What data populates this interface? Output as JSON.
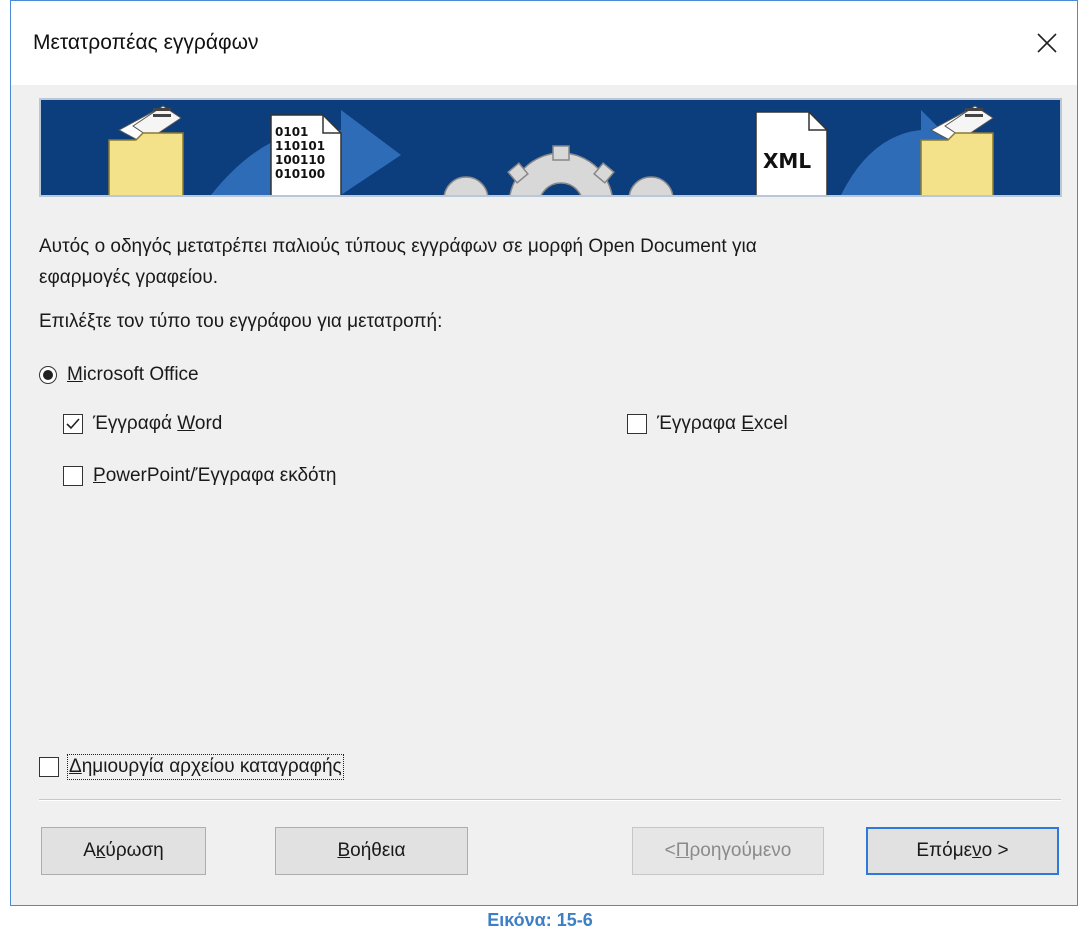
{
  "window": {
    "title": "Μετατροπέας εγγράφων",
    "close_glyph": "✕"
  },
  "banner": {
    "binary_lines": [
      "0101",
      "110101",
      "100110",
      "010100"
    ],
    "xml_label": "XML",
    "colors": {
      "background": "#0c3d7c",
      "arrow": "#2f6cb8",
      "folder": "#f3e28a"
    }
  },
  "content": {
    "description_line1": "Αυτός ο οδηγός μετατρέπει παλιούς τύπους εγγράφων σε μορφή Open Document για",
    "description_line2": "εφαρμογές γραφείου.",
    "prompt": "Επιλέξτε τον τύπο του εγγράφου για μετατροπή:"
  },
  "options": {
    "microsoft_office": {
      "prefix": "",
      "mnemonic": "M",
      "rest": "icrosoft Office",
      "selected": true
    },
    "word": {
      "prefix": "Έγγραφά ",
      "mnemonic": "W",
      "rest": "ord",
      "checked": true
    },
    "excel": {
      "prefix": "Έγγραφα ",
      "mnemonic": "E",
      "rest": "xcel",
      "checked": false
    },
    "powerpoint": {
      "prefix": "",
      "mnemonic": "P",
      "rest": "owerPoint/Έγγραφα εκδότη",
      "checked": false
    },
    "create_log": {
      "prefix": "",
      "mnemonic": "Δ",
      "rest": "ημιουργία αρχείου καταγραφής",
      "checked": false
    }
  },
  "buttons": {
    "cancel": {
      "prefix": "Α",
      "mnemonic": "κ",
      "rest": "ύρωση"
    },
    "help": {
      "prefix": "",
      "mnemonic": "Β",
      "rest": "οήθεια"
    },
    "back": {
      "prefix": "<",
      "mnemonic": "Π",
      "rest": "ροηγούμενο",
      "enabled": false
    },
    "next": {
      "prefix": "Επόμε",
      "mnemonic": "ν",
      "rest": "ο >",
      "default": true
    }
  },
  "caption": "Εικόνα: 15-6"
}
